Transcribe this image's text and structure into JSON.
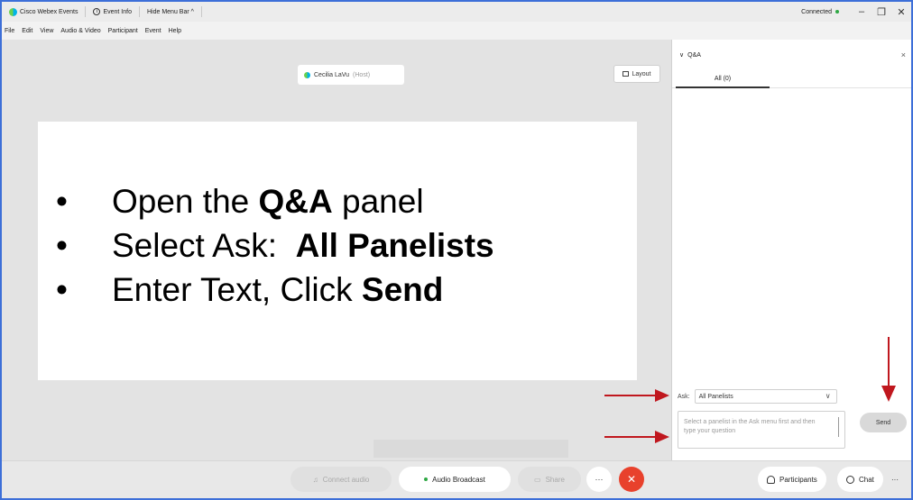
{
  "titlebar": {
    "app_name": "Cisco Webex Events",
    "event_info": "Event Info",
    "hide_menu": "Hide Menu Bar ^",
    "status": "Connected",
    "minimize": "–",
    "maximize": "❐",
    "close": "✕"
  },
  "menu": {
    "items": [
      "File",
      "Edit",
      "View",
      "Audio & Video",
      "Participant",
      "Event",
      "Help"
    ]
  },
  "stage": {
    "host_name": "Cecilia LaVu",
    "host_tag": "(Host)",
    "layout_label": "Layout"
  },
  "instructions": {
    "line1_pre": "Open the ",
    "line1_bold": "Q&A",
    "line1_post": " panel",
    "line2_pre": "Select Ask:  ",
    "line2_bold": "All Panelists",
    "line3_pre": "Enter Text, Click ",
    "line3_bold": "Send",
    "bullet": "•"
  },
  "qa": {
    "title": "Q&A",
    "collapse_glyph": "∨",
    "close_glyph": "×",
    "tab_all": "All (0)",
    "ask_label": "Ask:",
    "ask_value": "All Panelists",
    "ask_chevron": "∨",
    "placeholder": "Select a panelist in the Ask menu first and then type your question",
    "send_label": "Send"
  },
  "toolbar": {
    "connect_audio": "Connect audio",
    "audio_broadcast": "Audio Broadcast",
    "share": "Share",
    "more": "···",
    "end": "✕",
    "participants": "Participants",
    "chat": "Chat",
    "overflow": "···"
  },
  "colors": {
    "accent_border": "#3d6fd8",
    "arrow_red": "#c0171e",
    "end_button": "#e8412c",
    "connected_green": "#2fa844"
  }
}
